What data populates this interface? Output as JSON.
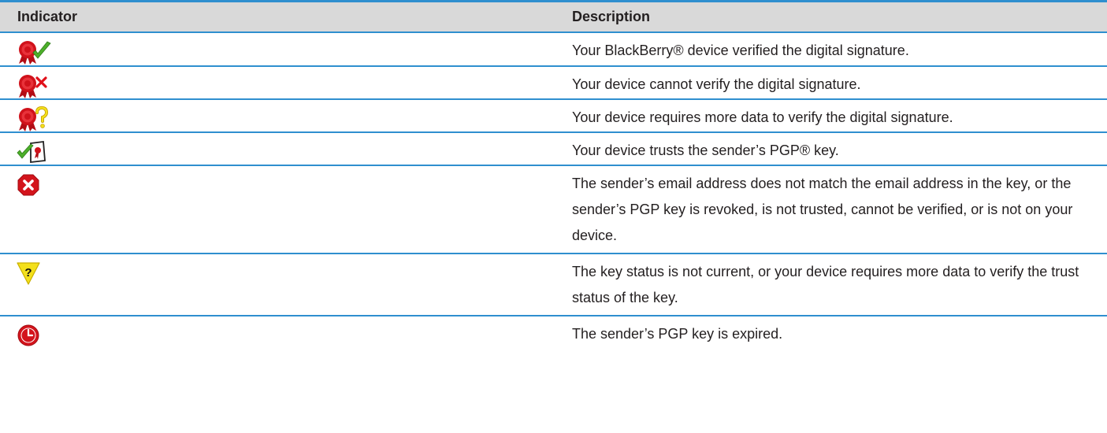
{
  "table": {
    "headers": {
      "indicator": "Indicator",
      "description": "Description"
    },
    "rows": [
      {
        "icon": "seal-check-icon",
        "description": "Your BlackBerry® device verified the digital signature."
      },
      {
        "icon": "seal-x-icon",
        "description": "Your device cannot verify the digital signature."
      },
      {
        "icon": "seal-question-icon",
        "description": "Your device requires more data to verify the digital signature."
      },
      {
        "icon": "trusted-key-icon",
        "description": "Your device trusts the sender’s PGP® key."
      },
      {
        "icon": "stop-x-icon",
        "description": "The sender’s email address does not match the email address in the key, or the sender’s PGP key is revoked, is not trusted, cannot be verified, or is not on your device."
      },
      {
        "icon": "warning-question-icon",
        "description": "The key status is not current, or your device requires more data to verify the trust status of the key."
      },
      {
        "icon": "expired-clock-icon",
        "description": "The sender’s PGP key is expired."
      }
    ]
  },
  "colors": {
    "rule": "#2f8fcf",
    "header_bg": "#d9d9d9",
    "seal_red": "#d0121b",
    "check_green": "#4caf2a",
    "warning_yellow": "#f3e01c"
  }
}
